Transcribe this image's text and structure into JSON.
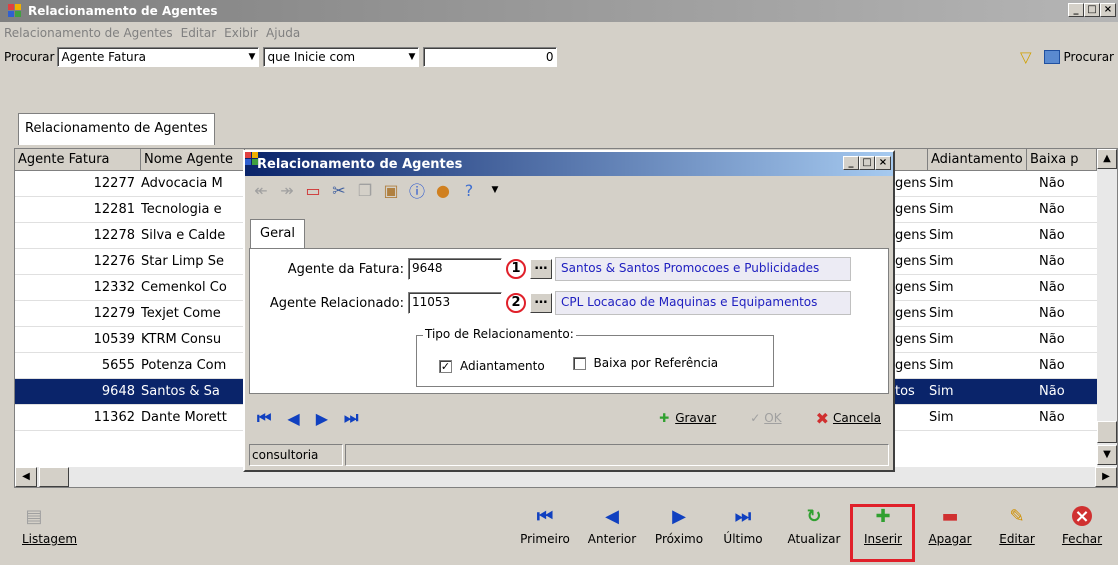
{
  "window": {
    "title": "Relacionamento de Agentes"
  },
  "menu": [
    "Relacionamento de Agentes",
    "Editar",
    "Exibir",
    "Ajuda"
  ],
  "search": {
    "label": "Procurar",
    "field_value": "Agente Fatura",
    "mode_value": "que Inicie com",
    "text_value": "0",
    "button_label": "Procurar"
  },
  "tab_label": "Relacionamento de Agentes",
  "grid": {
    "columns": [
      "Agente Fatura",
      "Nome Agente",
      "Adiantamento",
      "Baixa p"
    ],
    "rows": [
      {
        "id": "12277",
        "name": "Advocacia M",
        "tail": "gens",
        "adiant": "Sim",
        "baixa": "Não"
      },
      {
        "id": "12281",
        "name": "Tecnologia e",
        "tail": "gens",
        "adiant": "Sim",
        "baixa": "Não"
      },
      {
        "id": "12278",
        "name": "Silva e Calde",
        "tail": "gens",
        "adiant": "Sim",
        "baixa": "Não"
      },
      {
        "id": "12276",
        "name": "Star Limp Se",
        "tail": "gens",
        "adiant": "Sim",
        "baixa": "Não"
      },
      {
        "id": "12332",
        "name": "Cemenkol Co",
        "tail": "gens",
        "adiant": "Sim",
        "baixa": "Não"
      },
      {
        "id": "12279",
        "name": "Texjet Come",
        "tail": "gens",
        "adiant": "Sim",
        "baixa": "Não"
      },
      {
        "id": "10539",
        "name": "KTRM Consu",
        "tail": "gens",
        "adiant": "Sim",
        "baixa": "Não"
      },
      {
        "id": "5655",
        "name": "Potenza Com",
        "tail": "gens",
        "adiant": "Sim",
        "baixa": "Não"
      },
      {
        "id": "9648",
        "name": "Santos & Sa",
        "tail": "tos",
        "adiant": "Sim",
        "baixa": "Não"
      },
      {
        "id": "11362",
        "name": "Dante Morett",
        "tail": "",
        "adiant": "Sim",
        "baixa": "Não"
      }
    ],
    "selected_index": 8
  },
  "dialog": {
    "title": "Relacionamento de Agentes",
    "tab": "Geral",
    "agente_fatura": {
      "label": "Agente da Fatura:",
      "value": "9648",
      "marker": "1",
      "desc": "Santos & Santos Promocoes e Publicidades"
    },
    "agente_rel": {
      "label": "Agente Relacionado:",
      "value": "11053",
      "marker": "2",
      "desc": "CPL Locacao de Maquinas e Equipamentos"
    },
    "group_title": "Tipo de Relacionamento:",
    "adiantamento": {
      "label": "Adiantamento",
      "checked": "✓"
    },
    "baixa": {
      "label": "Baixa por Referência"
    },
    "gravar": "Gravar",
    "ok": "OK",
    "cancela": "Cancela",
    "status": "consultoria"
  },
  "bottom": {
    "listagem": "Listagem",
    "primeiro": "Primeiro",
    "anterior": "Anterior",
    "proximo": "Próximo",
    "ultimo": "Último",
    "atualizar": "Atualizar",
    "inserir": "Inserir",
    "apagar": "Apagar",
    "editar": "Editar",
    "fechar": "Fechar"
  }
}
